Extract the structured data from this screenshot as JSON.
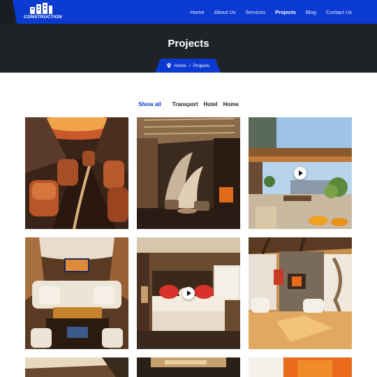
{
  "brand": {
    "name": "CONSTRUCTION",
    "logo_icon": "building-icon"
  },
  "nav": {
    "items": [
      {
        "label": "Home",
        "active": false
      },
      {
        "label": "About Us",
        "active": false
      },
      {
        "label": "Services",
        "active": false
      },
      {
        "label": "Projects",
        "active": true
      },
      {
        "label": "Blog",
        "active": false
      },
      {
        "label": "Contact Us",
        "active": false
      }
    ]
  },
  "hero": {
    "title": "Projects"
  },
  "breadcrumb": {
    "home": "Home",
    "separator": "/",
    "current": "Projects",
    "icon": "location-pin-icon"
  },
  "filters": [
    {
      "label": "Show all",
      "active": true
    },
    {
      "label": "Transport",
      "active": false
    },
    {
      "label": "Hotel",
      "active": false
    },
    {
      "label": "Home",
      "active": false
    }
  ],
  "projects": [
    {
      "name": "project-jet-cabin",
      "has_video": false
    },
    {
      "name": "project-hotel-lobby",
      "has_video": false
    },
    {
      "name": "project-rooftop-terrace",
      "has_video": true
    },
    {
      "name": "project-jet-lounge",
      "has_video": false
    },
    {
      "name": "project-hotel-bedroom",
      "has_video": true
    },
    {
      "name": "project-loft-living-room",
      "has_video": false
    },
    {
      "name": "project-row3-left",
      "has_video": false
    },
    {
      "name": "project-row3-middle",
      "has_video": false
    },
    {
      "name": "project-row3-right",
      "has_video": false
    }
  ],
  "colors": {
    "accent": "#0a3ad0",
    "dark": "#1f2328",
    "active_filter": "#0a3ad0"
  }
}
